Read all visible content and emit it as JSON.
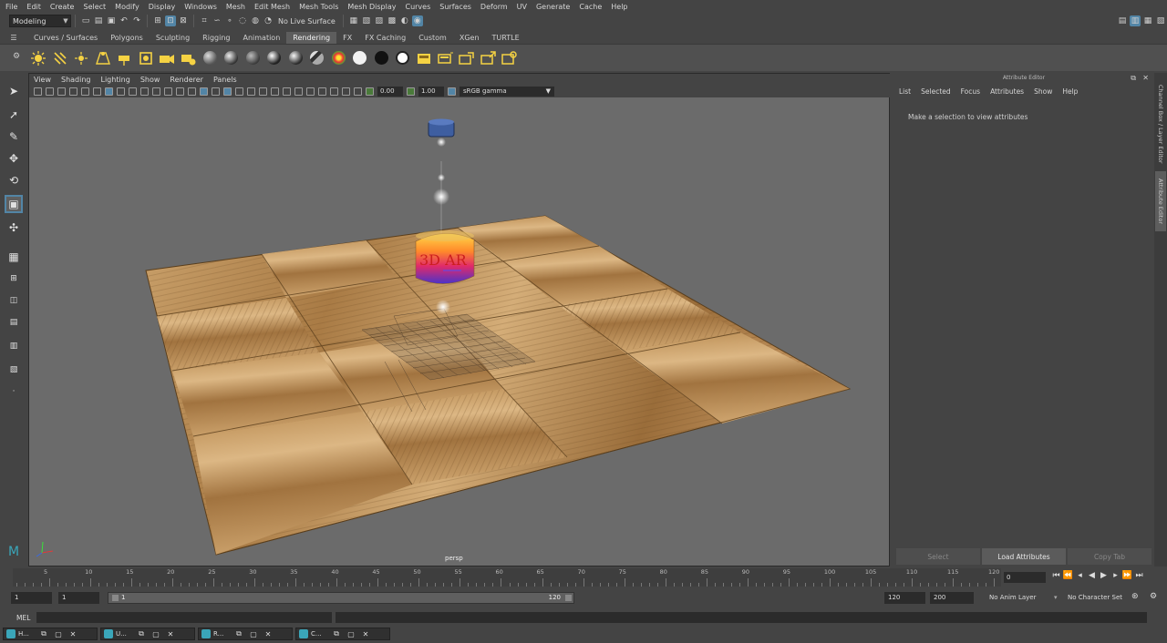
{
  "menu": [
    "File",
    "Edit",
    "Create",
    "Select",
    "Modify",
    "Display",
    "Windows",
    "Mesh",
    "Edit Mesh",
    "Mesh Tools",
    "Mesh Display",
    "Curves",
    "Surfaces",
    "Deform",
    "UV",
    "Generate",
    "Cache",
    "Help"
  ],
  "status_line": {
    "mode": "Modeling",
    "live_surface": "No Live Surface"
  },
  "shelf_tabs": [
    "Curves / Surfaces",
    "Polygons",
    "Sculpting",
    "Rigging",
    "Animation",
    "Rendering",
    "FX",
    "FX Caching",
    "Custom",
    "XGen",
    "TURTLE"
  ],
  "active_shelf_tab": "Rendering",
  "viewport": {
    "menu": [
      "View",
      "Shading",
      "Lighting",
      "Show",
      "Renderer",
      "Panels"
    ],
    "exposure": "0.00",
    "gamma_value": "1.00",
    "color_space": "sRGB gamma",
    "camera": "persp",
    "object_label": "3D AR"
  },
  "attribute_editor": {
    "title": "Attribute Editor",
    "menu": [
      "List",
      "Selected",
      "Focus",
      "Attributes",
      "Show",
      "Help"
    ],
    "message": "Make a selection to view attributes",
    "buttons": [
      "Select",
      "Load Attributes",
      "Copy Tab"
    ]
  },
  "side_tabs": [
    "Channel Box / Layer Editor",
    "Attribute Editor"
  ],
  "time_slider": {
    "ticks": [
      "5",
      "10",
      "15",
      "20",
      "25",
      "30",
      "35",
      "40",
      "45",
      "50",
      "55",
      "60",
      "65",
      "70",
      "75",
      "80",
      "85",
      "90",
      "95",
      "100",
      "105",
      "110",
      "115",
      "120"
    ],
    "current_frame": "0"
  },
  "range_slider": {
    "start": "1",
    "playback_start": "1",
    "range_left": "1",
    "range_right": "120",
    "playback_end": "120",
    "end": "200",
    "anim_layer": "No Anim Layer",
    "character_set": "No Character Set"
  },
  "command_line": {
    "label": "MEL"
  },
  "minimized_windows": [
    "H...",
    "U...",
    "R...",
    "C..."
  ],
  "colors": {
    "accent": "#5285a6",
    "viewport_bg": "#6b6b6b",
    "wood_light": "#c89a5e",
    "wood_dark": "#8a6236"
  }
}
